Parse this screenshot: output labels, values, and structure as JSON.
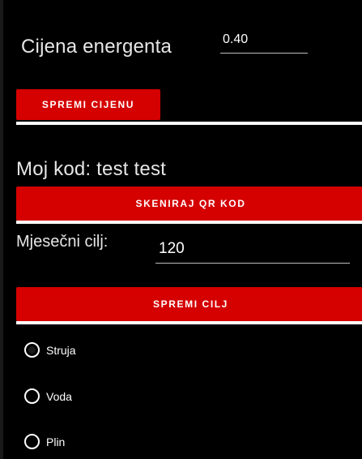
{
  "price_section": {
    "label": "Cijena energenta",
    "value": "0.40",
    "save_button": "SPREMI CIJENU"
  },
  "code_section": {
    "label": "Moj kod: test test",
    "scan_button": "SKENIRAJ QR KOD"
  },
  "goal_section": {
    "label": "Mjesečni cilj:",
    "value": "120",
    "save_button": "SPREMI CILJ"
  },
  "energy_type": {
    "selected": "Struja",
    "options": [
      {
        "label": "Struja",
        "checked": true
      },
      {
        "label": "Voda",
        "checked": false
      },
      {
        "label": "Plin",
        "checked": false
      }
    ]
  },
  "colors": {
    "button": "#d50000",
    "background": "#000000",
    "divider": "#ffffff"
  }
}
